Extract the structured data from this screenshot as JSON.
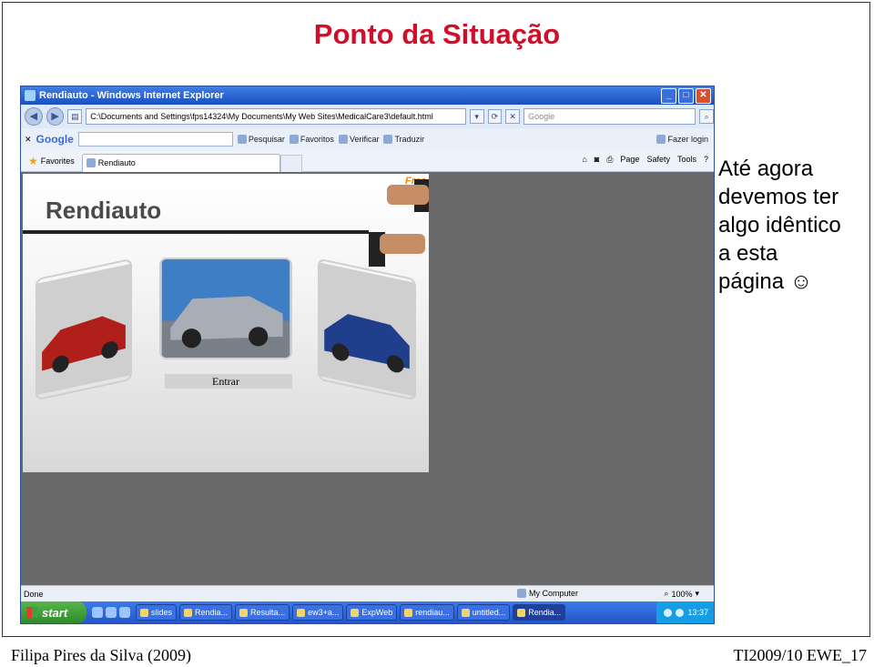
{
  "slide": {
    "title": "Ponto da Situação",
    "bullet_lines": [
      "Até agora",
      "devemos ter",
      "algo idêntico",
      "a esta",
      "página ☺"
    ],
    "footer_left": "Filipa Pires da Silva (2009)",
    "footer_right": "TI2009/10 EWE_17"
  },
  "browser": {
    "window_title": "Rendiauto - Windows Internet Explorer",
    "address": "C:\\Documents and Settings\\fps14324\\My Documents\\My Web Sites\\MedicalCare3\\default.html",
    "search_placeholder": "Google",
    "google_toolbar": {
      "logo": "Google",
      "items": [
        "Pesquisar",
        "Favoritos",
        "Verificar",
        "Traduzir",
        "Fazer login"
      ]
    },
    "favorites_label": "Favorites",
    "tab_label": "Rendiauto",
    "command_items": [
      "Page",
      "Safety",
      "Tools"
    ],
    "status": {
      "text": "Done",
      "zone": "My Computer",
      "zoom": "100%"
    }
  },
  "website": {
    "logo": "Rendiauto",
    "free_badge": "Free",
    "entrar": "Entrar",
    "car_colors": [
      "#b01f1a",
      "#a9aeb6",
      "#1f3f8c"
    ]
  },
  "taskbar": {
    "start": "start",
    "tasks": [
      "slides",
      "Rendia...",
      "Resulta...",
      "ew3+a...",
      "ExpWeb",
      "rendiau...",
      "untitled...",
      "Rendia..."
    ],
    "clock": "13:37"
  }
}
